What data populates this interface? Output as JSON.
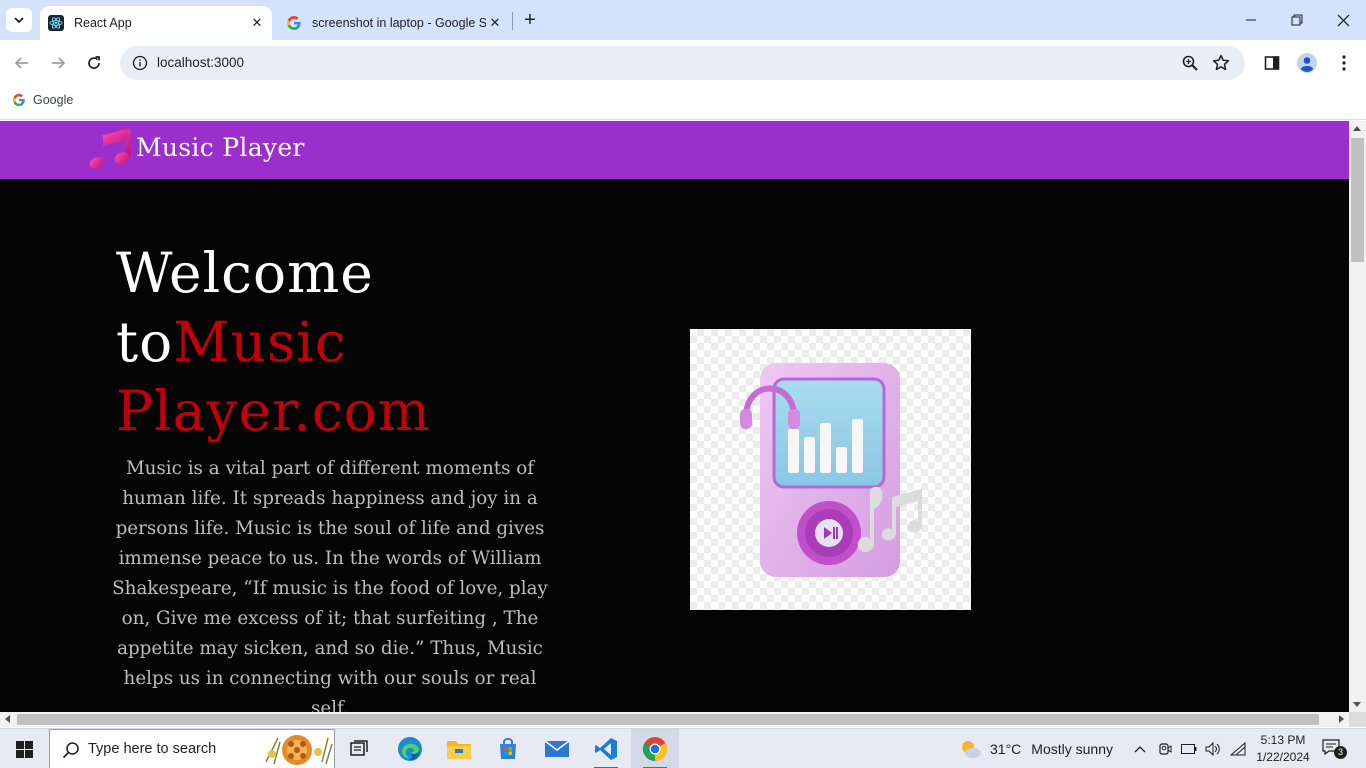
{
  "browser": {
    "tabs": [
      {
        "title": "React App",
        "favicon": "react-icon",
        "active": true
      },
      {
        "title": "screenshot in laptop - Google S",
        "favicon": "google-icon",
        "active": false
      }
    ],
    "url": "localhost:3000",
    "bookmarks": [
      {
        "label": "Google",
        "icon": "google-icon"
      }
    ]
  },
  "page": {
    "navbar": {
      "brand": "Music Player",
      "logo": "music-note-icon"
    },
    "hero": {
      "title_prefix": "Welcome to",
      "title_accent": "Music Player.com",
      "paragraph": "Music is a vital part of different moments of human life. It spreads happiness and joy in a persons life. Music is the soul of life and gives immense peace to us. In the words of William Shakespeare, “If music is the food of love, play on, Give me excess of it; that surfeiting , The appetite may sicken, and so die.” Thus, Music helps us in connecting with our souls or real self.",
      "image": "music-player-illustration"
    }
  },
  "taskbar": {
    "search_placeholder": "Type here to search",
    "weather": {
      "temp": "31°C",
      "desc": "Mostly sunny"
    },
    "time": "5:13 PM",
    "date": "1/22/2024",
    "notification_count": "3"
  },
  "colors": {
    "navbar": "#9b2fcc",
    "accent": "#c0000a",
    "page_bg": "#050505",
    "tabstrip": "#d3e3fd"
  }
}
